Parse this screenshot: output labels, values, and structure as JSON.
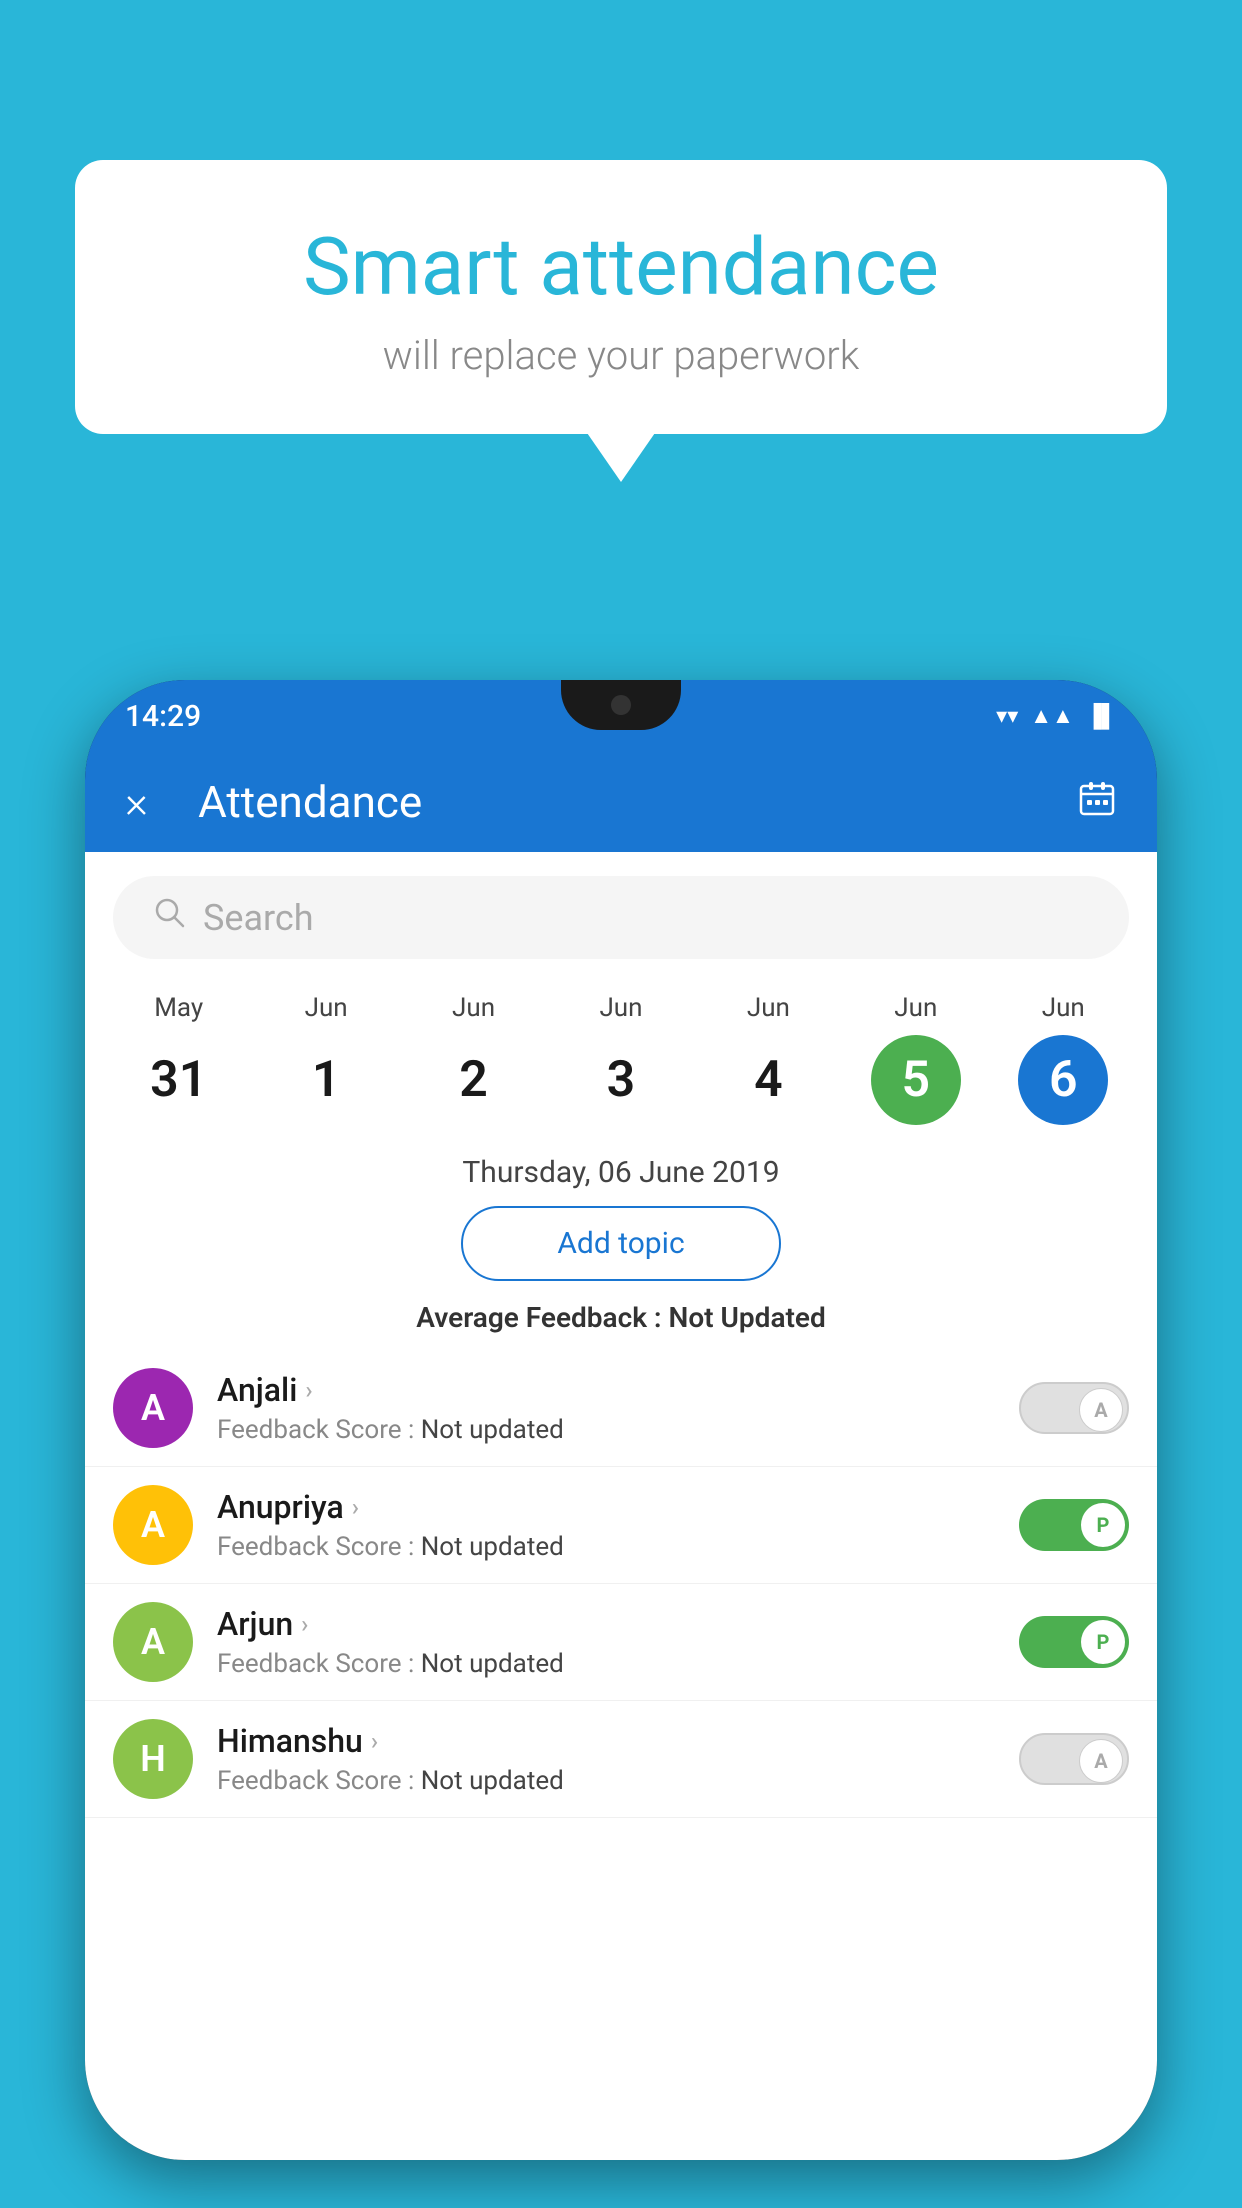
{
  "background_color": "#29B6D8",
  "bubble": {
    "title": "Smart attendance",
    "subtitle": "will replace your paperwork"
  },
  "status_bar": {
    "time": "14:29",
    "icons": [
      "wifi",
      "signal",
      "battery"
    ]
  },
  "app_bar": {
    "title": "Attendance",
    "close_icon": "×",
    "calendar_icon": "📅"
  },
  "search": {
    "placeholder": "Search"
  },
  "calendar": {
    "days": [
      {
        "month": "May",
        "date": "31",
        "state": "normal"
      },
      {
        "month": "Jun",
        "date": "1",
        "state": "normal"
      },
      {
        "month": "Jun",
        "date": "2",
        "state": "normal"
      },
      {
        "month": "Jun",
        "date": "3",
        "state": "normal"
      },
      {
        "month": "Jun",
        "date": "4",
        "state": "normal"
      },
      {
        "month": "Jun",
        "date": "5",
        "state": "today"
      },
      {
        "month": "Jun",
        "date": "6",
        "state": "selected"
      }
    ]
  },
  "selected_date_label": "Thursday, 06 June 2019",
  "add_topic_label": "Add topic",
  "average_feedback": {
    "label": "Average Feedback :",
    "value": "Not Updated"
  },
  "students": [
    {
      "name": "Anjali",
      "avatar_letter": "A",
      "avatar_color": "#9C27B0",
      "feedback_label": "Feedback Score :",
      "feedback_value": "Not updated",
      "toggle_state": "off",
      "toggle_label": "A"
    },
    {
      "name": "Anupriya",
      "avatar_letter": "A",
      "avatar_color": "#FFC107",
      "feedback_label": "Feedback Score :",
      "feedback_value": "Not updated",
      "toggle_state": "on",
      "toggle_label": "P"
    },
    {
      "name": "Arjun",
      "avatar_letter": "A",
      "avatar_color": "#8BC34A",
      "feedback_label": "Feedback Score :",
      "feedback_value": "Not updated",
      "toggle_state": "on",
      "toggle_label": "P"
    },
    {
      "name": "Himanshu",
      "avatar_letter": "H",
      "avatar_color": "#8BC34A",
      "feedback_label": "Feedback Score :",
      "feedback_value": "Not updated",
      "toggle_state": "off",
      "toggle_label": "A"
    }
  ]
}
